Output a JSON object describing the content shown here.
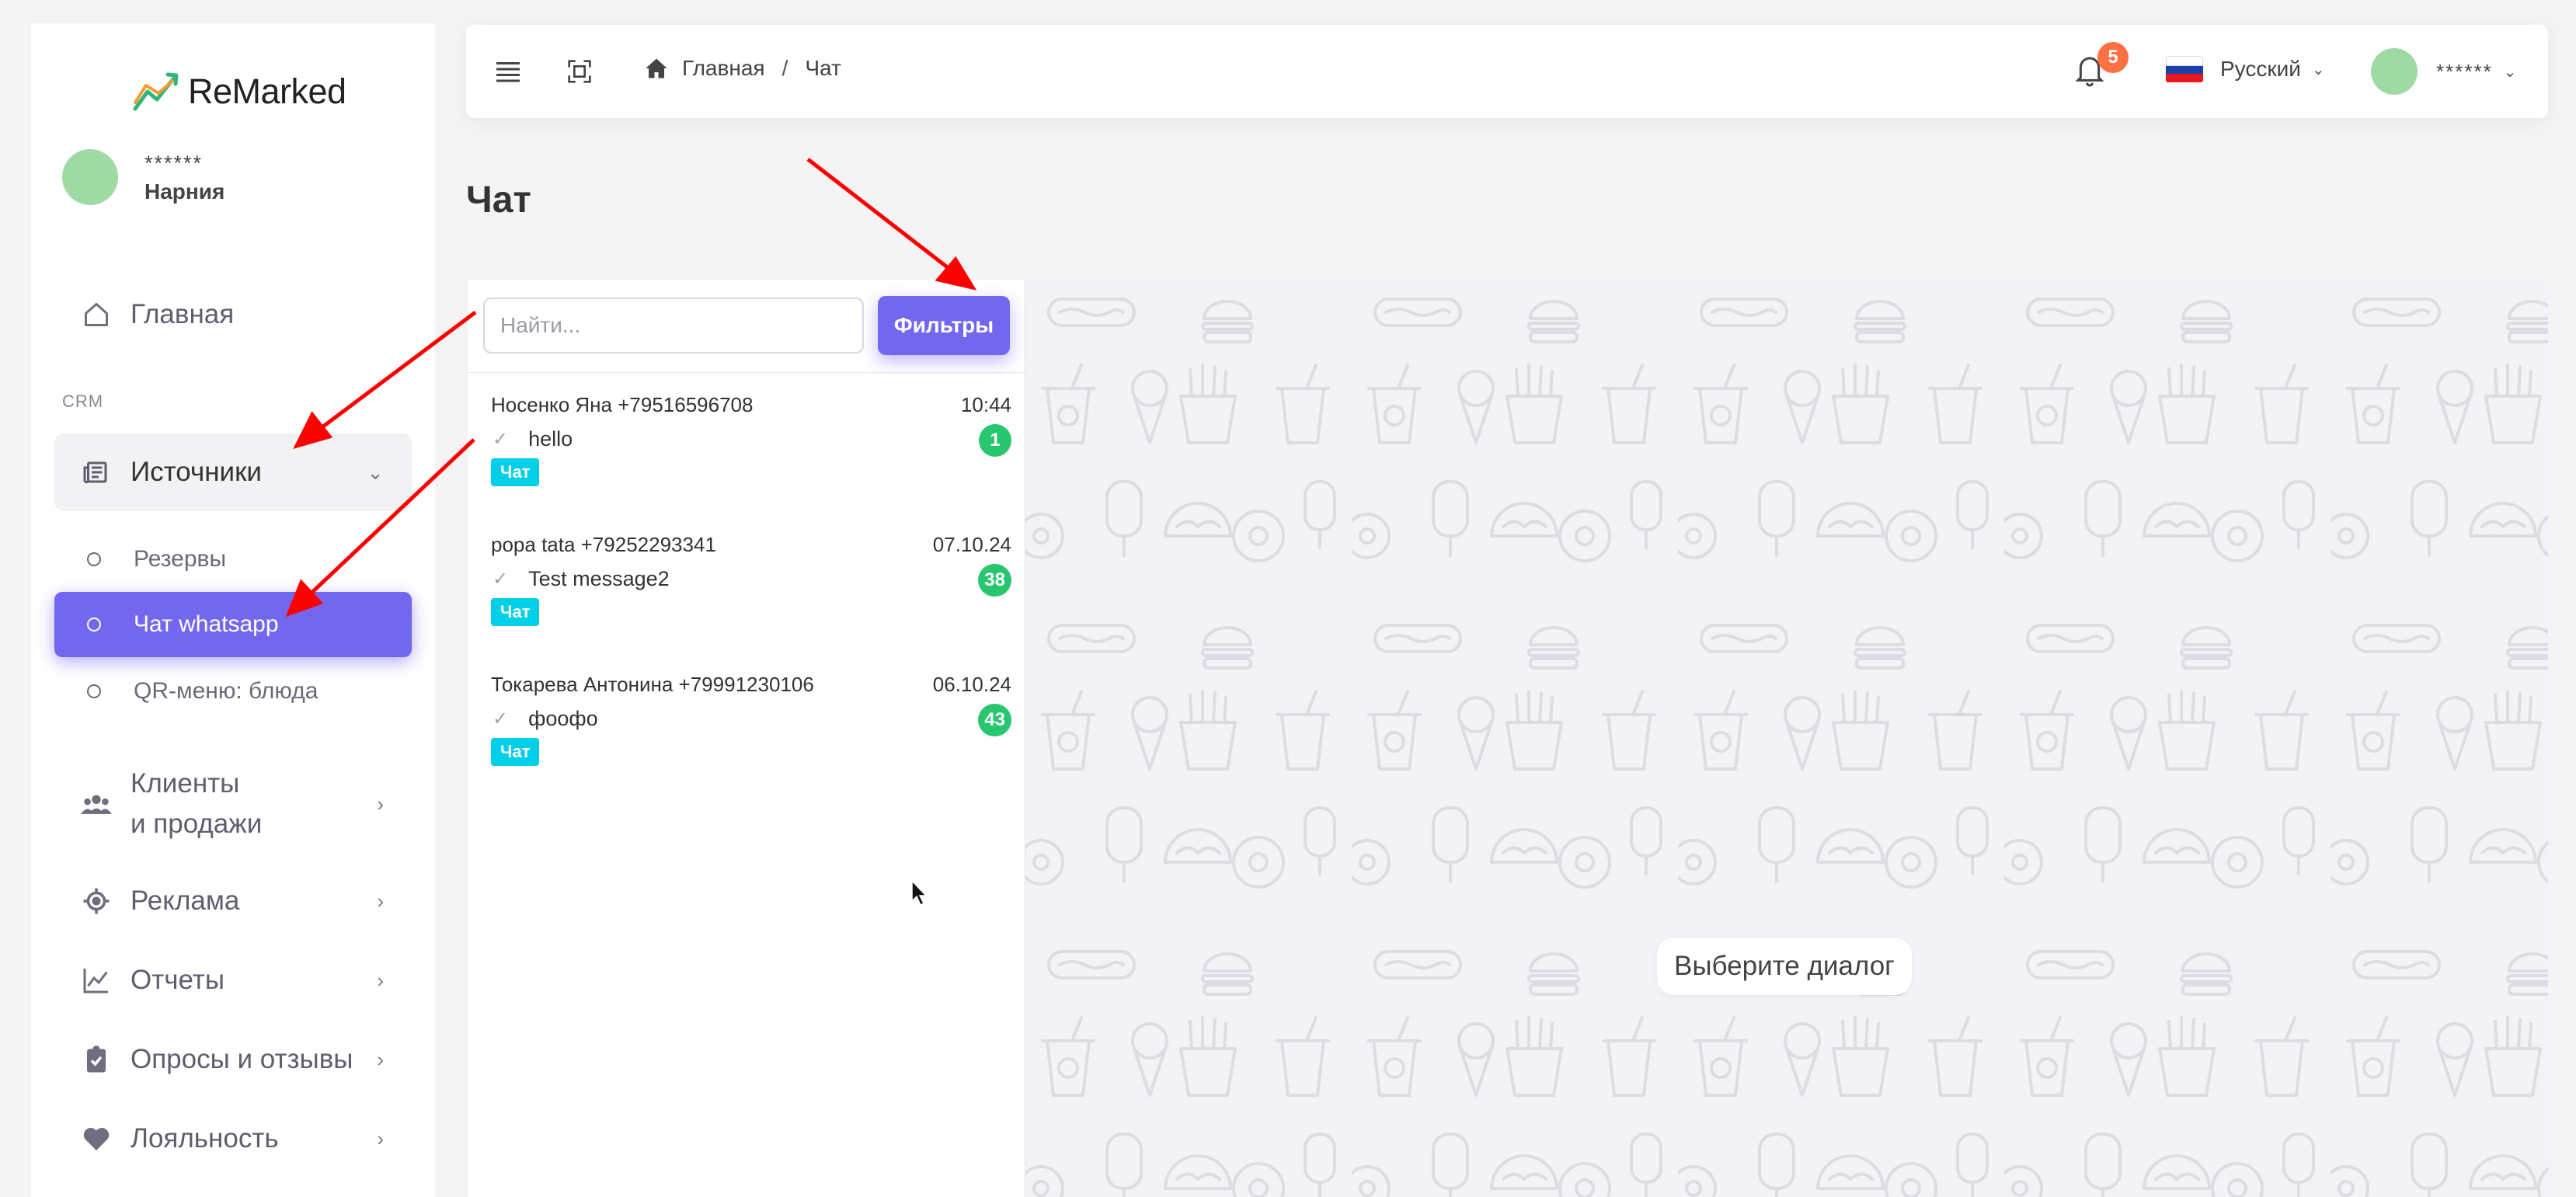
{
  "app": {
    "logo_text": "ReMarked"
  },
  "user": {
    "name_masked": "******",
    "role": "Нарния"
  },
  "sidebar": {
    "home_label": "Главная",
    "section_crm": "CRM",
    "sources_label": "Источники",
    "sub_items": [
      {
        "label": "Резервы"
      },
      {
        "label": "Чат whatsapp"
      },
      {
        "label": "QR-меню: блюда"
      }
    ],
    "clients_line1": "Клиенты",
    "clients_line2": "и продажи",
    "ads_label": "Реклама",
    "reports_label": "Отчеты",
    "surveys_label": "Опросы и отзывы",
    "loyalty_label": "Лояльность"
  },
  "topbar": {
    "breadcrumb_home": "Главная",
    "breadcrumb_sep": "/",
    "breadcrumb_current": "Чат",
    "notifications_count": "5",
    "language": "Русский",
    "user_masked": "******"
  },
  "page": {
    "title": "Чат"
  },
  "chat_list": {
    "search_placeholder": "Найти...",
    "filter_button": "Фильтры",
    "conversations": [
      {
        "name": "Носенко Яна +79516596708",
        "time": "10:44",
        "last_message": "hello",
        "unread": "1",
        "tag": "Чат"
      },
      {
        "name": "popa tata +79252293341",
        "time": "07.10.24",
        "last_message": "Test message2",
        "unread": "38",
        "tag": "Чат"
      },
      {
        "name": "Токарева Антонина +79991230106",
        "time": "06.10.24",
        "last_message": "фоофо",
        "unread": "43",
        "tag": "Чат"
      }
    ]
  },
  "chat_area": {
    "empty_state": "Выберите диалог"
  },
  "colors": {
    "accent": "#7367f0",
    "success": "#28c76f",
    "info": "#00cfe8",
    "notification": "#ff7043",
    "annotation_arrow": "#ff0000"
  }
}
